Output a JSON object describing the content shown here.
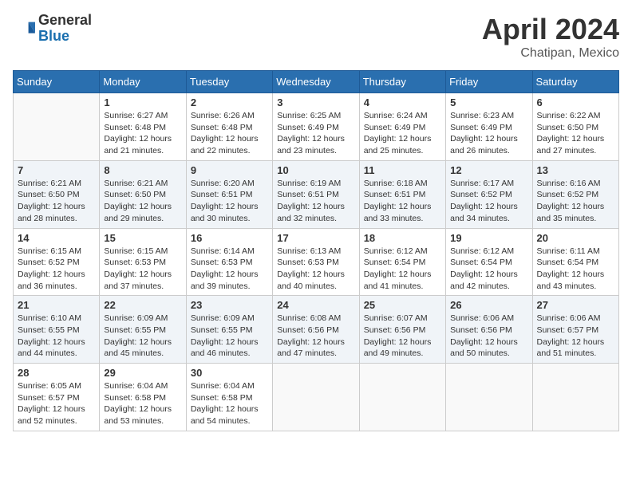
{
  "header": {
    "logo_general": "General",
    "logo_blue": "Blue",
    "month_title": "April 2024",
    "location": "Chatipan, Mexico"
  },
  "days_of_week": [
    "Sunday",
    "Monday",
    "Tuesday",
    "Wednesday",
    "Thursday",
    "Friday",
    "Saturday"
  ],
  "weeks": [
    [
      {
        "day": "",
        "sunrise": "",
        "sunset": "",
        "daylight": ""
      },
      {
        "day": "1",
        "sunrise": "Sunrise: 6:27 AM",
        "sunset": "Sunset: 6:48 PM",
        "daylight": "Daylight: 12 hours and 21 minutes."
      },
      {
        "day": "2",
        "sunrise": "Sunrise: 6:26 AM",
        "sunset": "Sunset: 6:48 PM",
        "daylight": "Daylight: 12 hours and 22 minutes."
      },
      {
        "day": "3",
        "sunrise": "Sunrise: 6:25 AM",
        "sunset": "Sunset: 6:49 PM",
        "daylight": "Daylight: 12 hours and 23 minutes."
      },
      {
        "day": "4",
        "sunrise": "Sunrise: 6:24 AM",
        "sunset": "Sunset: 6:49 PM",
        "daylight": "Daylight: 12 hours and 25 minutes."
      },
      {
        "day": "5",
        "sunrise": "Sunrise: 6:23 AM",
        "sunset": "Sunset: 6:49 PM",
        "daylight": "Daylight: 12 hours and 26 minutes."
      },
      {
        "day": "6",
        "sunrise": "Sunrise: 6:22 AM",
        "sunset": "Sunset: 6:50 PM",
        "daylight": "Daylight: 12 hours and 27 minutes."
      }
    ],
    [
      {
        "day": "7",
        "sunrise": "Sunrise: 6:21 AM",
        "sunset": "Sunset: 6:50 PM",
        "daylight": "Daylight: 12 hours and 28 minutes."
      },
      {
        "day": "8",
        "sunrise": "Sunrise: 6:21 AM",
        "sunset": "Sunset: 6:50 PM",
        "daylight": "Daylight: 12 hours and 29 minutes."
      },
      {
        "day": "9",
        "sunrise": "Sunrise: 6:20 AM",
        "sunset": "Sunset: 6:51 PM",
        "daylight": "Daylight: 12 hours and 30 minutes."
      },
      {
        "day": "10",
        "sunrise": "Sunrise: 6:19 AM",
        "sunset": "Sunset: 6:51 PM",
        "daylight": "Daylight: 12 hours and 32 minutes."
      },
      {
        "day": "11",
        "sunrise": "Sunrise: 6:18 AM",
        "sunset": "Sunset: 6:51 PM",
        "daylight": "Daylight: 12 hours and 33 minutes."
      },
      {
        "day": "12",
        "sunrise": "Sunrise: 6:17 AM",
        "sunset": "Sunset: 6:52 PM",
        "daylight": "Daylight: 12 hours and 34 minutes."
      },
      {
        "day": "13",
        "sunrise": "Sunrise: 6:16 AM",
        "sunset": "Sunset: 6:52 PM",
        "daylight": "Daylight: 12 hours and 35 minutes."
      }
    ],
    [
      {
        "day": "14",
        "sunrise": "Sunrise: 6:15 AM",
        "sunset": "Sunset: 6:52 PM",
        "daylight": "Daylight: 12 hours and 36 minutes."
      },
      {
        "day": "15",
        "sunrise": "Sunrise: 6:15 AM",
        "sunset": "Sunset: 6:53 PM",
        "daylight": "Daylight: 12 hours and 37 minutes."
      },
      {
        "day": "16",
        "sunrise": "Sunrise: 6:14 AM",
        "sunset": "Sunset: 6:53 PM",
        "daylight": "Daylight: 12 hours and 39 minutes."
      },
      {
        "day": "17",
        "sunrise": "Sunrise: 6:13 AM",
        "sunset": "Sunset: 6:53 PM",
        "daylight": "Daylight: 12 hours and 40 minutes."
      },
      {
        "day": "18",
        "sunrise": "Sunrise: 6:12 AM",
        "sunset": "Sunset: 6:54 PM",
        "daylight": "Daylight: 12 hours and 41 minutes."
      },
      {
        "day": "19",
        "sunrise": "Sunrise: 6:12 AM",
        "sunset": "Sunset: 6:54 PM",
        "daylight": "Daylight: 12 hours and 42 minutes."
      },
      {
        "day": "20",
        "sunrise": "Sunrise: 6:11 AM",
        "sunset": "Sunset: 6:54 PM",
        "daylight": "Daylight: 12 hours and 43 minutes."
      }
    ],
    [
      {
        "day": "21",
        "sunrise": "Sunrise: 6:10 AM",
        "sunset": "Sunset: 6:55 PM",
        "daylight": "Daylight: 12 hours and 44 minutes."
      },
      {
        "day": "22",
        "sunrise": "Sunrise: 6:09 AM",
        "sunset": "Sunset: 6:55 PM",
        "daylight": "Daylight: 12 hours and 45 minutes."
      },
      {
        "day": "23",
        "sunrise": "Sunrise: 6:09 AM",
        "sunset": "Sunset: 6:55 PM",
        "daylight": "Daylight: 12 hours and 46 minutes."
      },
      {
        "day": "24",
        "sunrise": "Sunrise: 6:08 AM",
        "sunset": "Sunset: 6:56 PM",
        "daylight": "Daylight: 12 hours and 47 minutes."
      },
      {
        "day": "25",
        "sunrise": "Sunrise: 6:07 AM",
        "sunset": "Sunset: 6:56 PM",
        "daylight": "Daylight: 12 hours and 49 minutes."
      },
      {
        "day": "26",
        "sunrise": "Sunrise: 6:06 AM",
        "sunset": "Sunset: 6:56 PM",
        "daylight": "Daylight: 12 hours and 50 minutes."
      },
      {
        "day": "27",
        "sunrise": "Sunrise: 6:06 AM",
        "sunset": "Sunset: 6:57 PM",
        "daylight": "Daylight: 12 hours and 51 minutes."
      }
    ],
    [
      {
        "day": "28",
        "sunrise": "Sunrise: 6:05 AM",
        "sunset": "Sunset: 6:57 PM",
        "daylight": "Daylight: 12 hours and 52 minutes."
      },
      {
        "day": "29",
        "sunrise": "Sunrise: 6:04 AM",
        "sunset": "Sunset: 6:58 PM",
        "daylight": "Daylight: 12 hours and 53 minutes."
      },
      {
        "day": "30",
        "sunrise": "Sunrise: 6:04 AM",
        "sunset": "Sunset: 6:58 PM",
        "daylight": "Daylight: 12 hours and 54 minutes."
      },
      {
        "day": "",
        "sunrise": "",
        "sunset": "",
        "daylight": ""
      },
      {
        "day": "",
        "sunrise": "",
        "sunset": "",
        "daylight": ""
      },
      {
        "day": "",
        "sunrise": "",
        "sunset": "",
        "daylight": ""
      },
      {
        "day": "",
        "sunrise": "",
        "sunset": "",
        "daylight": ""
      }
    ]
  ]
}
